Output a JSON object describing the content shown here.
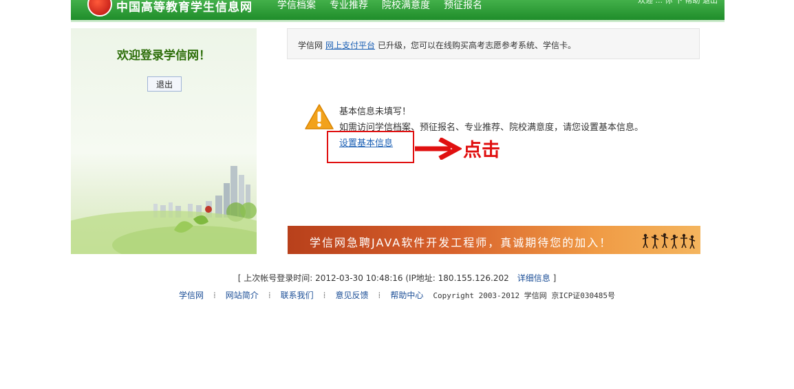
{
  "header": {
    "site_title": "中国高等教育学生信息网",
    "nav": [
      "学信档案",
      "专业推荐",
      "院校满意度",
      "预征报名"
    ],
    "welcome_user": "欢迎 ... 你 下 帮助 退出",
    "bg_color": "#2a9a34"
  },
  "left_panel": {
    "welcome": "欢迎登录学信网！",
    "logout_label": "退出"
  },
  "notice": {
    "prefix": "学信网",
    "link": "网上支付平台",
    "suffix": "已升级，您可以在线购买高考志愿参考系统、学信卡。"
  },
  "warning": {
    "icon": "warning-triangle-icon",
    "title": "基本信息未填写！",
    "description": "如需访问学信档案、预征报名、专业推荐、院校满意度，请您设置基本信息。",
    "setup_link": "设置基本信息"
  },
  "annotation": {
    "click_text": "点击",
    "color": "#e01010"
  },
  "banner": {
    "text": "学信网急聘JAVA软件开发工程师，真诚期待您的加入！"
  },
  "footer": {
    "login_info": "[ 上次帐号登录时间: 2012-03-30 10:48:16 (IP地址: 180.155.126.202",
    "details_link": "详细信息",
    "login_info_end": "]",
    "links": [
      "学信网",
      "网站简介",
      "联系我们",
      "意见反馈",
      "帮助中心"
    ],
    "copyright": "Copyright 2003-2012 学信网 京ICP证030485号"
  }
}
